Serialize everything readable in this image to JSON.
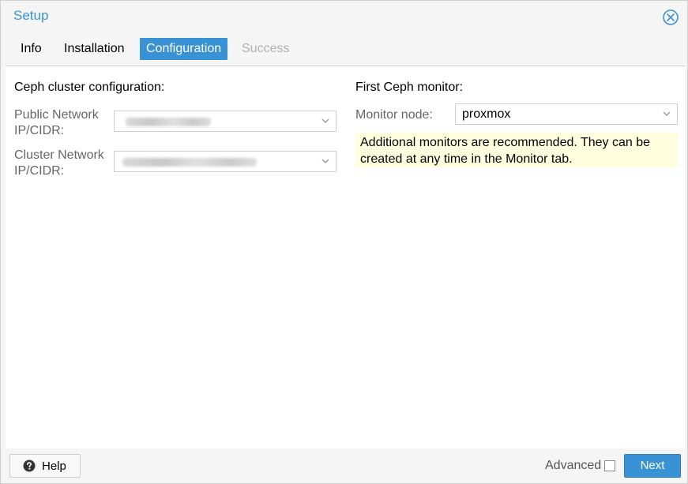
{
  "window": {
    "title": "Setup"
  },
  "tabs": [
    {
      "label": "Info",
      "state": "normal"
    },
    {
      "label": "Installation",
      "state": "normal"
    },
    {
      "label": "Configuration",
      "state": "active"
    },
    {
      "label": "Success",
      "state": "disabled"
    }
  ],
  "left": {
    "section_title": "Ceph cluster configuration:",
    "public_network": {
      "label_line1": "Public Network",
      "label_line2": "IP/CIDR:",
      "value": ""
    },
    "cluster_network": {
      "label_line1": "Cluster Network",
      "label_line2": "IP/CIDR:",
      "value": ""
    }
  },
  "right": {
    "section_title": "First Ceph monitor:",
    "monitor_node": {
      "label": "Monitor node:",
      "value": "proxmox"
    },
    "info_text": "Additional monitors are recommended. They can be created at any time in the Monitor tab."
  },
  "footer": {
    "help_label": "Help",
    "advanced_label": "Advanced",
    "advanced_checked": false,
    "next_label": "Next"
  },
  "colors": {
    "accent": "#3892d4",
    "info_background": "#ffffe0",
    "disabled_text": "#b0b0b0"
  },
  "icons": [
    "close-circle-icon",
    "chevron-down-icon",
    "question-circle-icon"
  ]
}
